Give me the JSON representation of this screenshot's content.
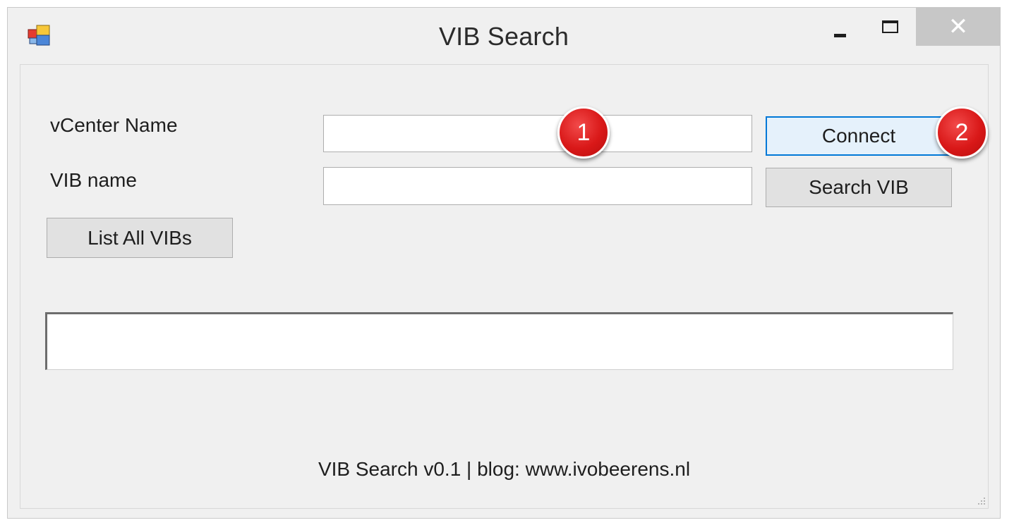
{
  "window": {
    "title": "VIB Search",
    "close_glyph": "✕",
    "icons": {
      "app": "winforms-app-icon",
      "minimize": "minimize-icon",
      "maximize": "maximize-icon",
      "close": "close-icon"
    }
  },
  "form": {
    "vcenter_label": "vCenter Name",
    "vcenter_value": "",
    "vib_label": "VIB name",
    "vib_value": "",
    "connect_label": "Connect",
    "search_label": "Search VIB",
    "list_all_label": "List All VIBs",
    "output_text": ""
  },
  "footer": {
    "text": "VIB Search v0.1 | blog: www.ivobeerens.nl"
  },
  "annotations": [
    {
      "number": "1",
      "color": "#d91818"
    },
    {
      "number": "2",
      "color": "#d91818"
    }
  ],
  "colors": {
    "accent": "#0078d7",
    "window_bg": "#f0f0f0",
    "close_bg": "#c7c7c7"
  }
}
